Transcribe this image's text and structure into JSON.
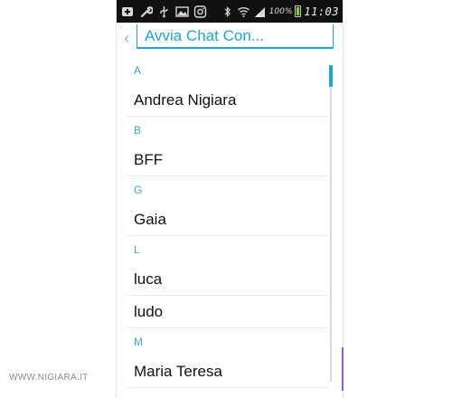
{
  "status_bar": {
    "battery_percent": "100%",
    "time": "11:03",
    "icons_left": [
      "add-box-icon",
      "wrench-icon",
      "usb-icon",
      "image-icon",
      "instagram-icon"
    ],
    "icons_right": [
      "bluetooth-icon",
      "wifi-icon",
      "signal-icon",
      "battery-icon"
    ]
  },
  "header": {
    "back_symbol": "‹",
    "search_placeholder": "Avvia Chat Con..."
  },
  "contacts": {
    "sections": [
      {
        "letter": "A",
        "names": [
          "Andrea Nigiara"
        ]
      },
      {
        "letter": "B",
        "names": [
          "BFF"
        ]
      },
      {
        "letter": "G",
        "names": [
          "Gaia"
        ]
      },
      {
        "letter": "L",
        "names": [
          "luca",
          "ludo"
        ]
      },
      {
        "letter": "M",
        "names": [
          "Maria Teresa"
        ]
      }
    ]
  },
  "watermark": "WWW.NIGIARA.IT",
  "colors": {
    "accent": "#1aa6dd",
    "section_header": "#3ea5d6",
    "status_bar_bg": "#111111",
    "battery_fill": "#7cd322"
  }
}
